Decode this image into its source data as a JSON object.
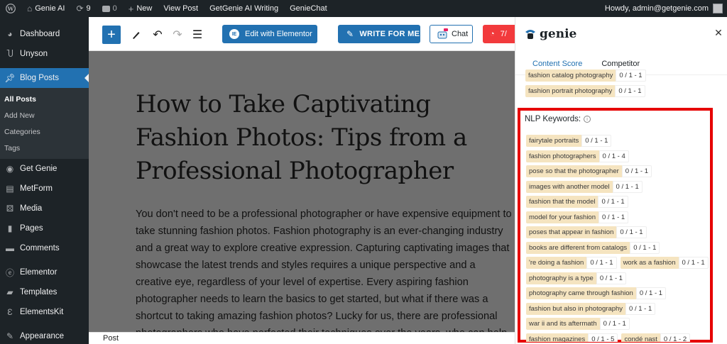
{
  "adminbar": {
    "site_name": "Genie AI",
    "updates_count": "9",
    "comments_count": "0",
    "new_label": "New",
    "view_post": "View Post",
    "getgenie_writing": "GetGenie AI Writing",
    "geniechat": "GenieChat",
    "howdy": "Howdy, admin@getgenie.com"
  },
  "sidebar": {
    "items": [
      {
        "label": "Dashboard",
        "icon": "dashboard-icon"
      },
      {
        "label": "Unyson",
        "icon": "unyson-icon"
      },
      {
        "label": "Blog Posts",
        "icon": "pin-icon",
        "active": true
      },
      {
        "label": "Get Genie",
        "icon": "genie-icon"
      },
      {
        "label": "MetForm",
        "icon": "form-icon"
      },
      {
        "label": "Media",
        "icon": "media-icon"
      },
      {
        "label": "Pages",
        "icon": "pages-icon"
      },
      {
        "label": "Comments",
        "icon": "comment-icon"
      },
      {
        "label": "Elementor",
        "icon": "elementor-icon"
      },
      {
        "label": "Templates",
        "icon": "folder-icon"
      },
      {
        "label": "ElementsKit",
        "icon": "elementskit-icon"
      },
      {
        "label": "Appearance",
        "icon": "brush-icon"
      }
    ],
    "submenu": [
      "All Posts",
      "Add New",
      "Categories",
      "Tags"
    ]
  },
  "toolbar": {
    "edit_elementor": "Edit with Elementor",
    "write_for_me": "WRITE FOR ME",
    "chat": "Chat",
    "red_button": "7/"
  },
  "editor": {
    "title": "How to Take Captivating Fashion Photos: Tips from a Professional Photographer",
    "body": "You don't need to be a professional photographer or have expensive equipment to take stunning fashion photos. Fashion photography is an ever-changing industry and a great way to explore creative expression. Capturing captivating images that showcase the latest trends and styles requires a unique perspective and a creative eye, regardless of your level of expertise. Every aspiring fashion photographer needs to learn the basics to get started, but what if there was a shortcut to taking amazing fashion photos? Lucky for us, there are professional photographers who have perfected their techniques over the years, who can help",
    "status_label": "Post"
  },
  "panel": {
    "logo_text": "genie",
    "tabs": [
      "Content Score",
      "Competitor"
    ],
    "top_keywords": [
      {
        "kw": "fashion catalog photography",
        "ct": "0 / 1 - 1"
      },
      {
        "kw": "fashion portrait photography",
        "ct": "0 / 1 - 1"
      }
    ],
    "nlp_title": "NLP Keywords:",
    "nlp_rows": [
      [
        {
          "kw": "fairytale portraits",
          "ct": "0 / 1 - 1"
        }
      ],
      [
        {
          "kw": "fashion photographers",
          "ct": "0 / 1 - 4"
        }
      ],
      [
        {
          "kw": "pose so that the photographer",
          "ct": "0 / 1 - 1"
        }
      ],
      [
        {
          "kw": "images with another model",
          "ct": "0 / 1 - 1"
        }
      ],
      [
        {
          "kw": "fashion that the model",
          "ct": "0 / 1 - 1"
        }
      ],
      [
        {
          "kw": "model for your fashion",
          "ct": "0 / 1 - 1"
        }
      ],
      [
        {
          "kw": "poses that appear in fashion",
          "ct": "0 / 1 - 1"
        }
      ],
      [
        {
          "kw": "books are different from catalogs",
          "ct": "0 / 1 - 1"
        }
      ],
      [
        {
          "kw": "'re doing a fashion",
          "ct": "0 / 1 - 1"
        },
        {
          "kw": "work as a fashion",
          "ct": "0 / 1 - 1"
        }
      ],
      [
        {
          "kw": "photography is a type",
          "ct": "0 / 1 - 1"
        }
      ],
      [
        {
          "kw": "photography came through fashion",
          "ct": "0 / 1 - 1"
        }
      ],
      [
        {
          "kw": "fashion but also in photography",
          "ct": "0 / 1 - 1"
        }
      ],
      [
        {
          "kw": "war ii and its aftermath",
          "ct": "0 / 1 - 1"
        }
      ],
      [
        {
          "kw": "fashion magazines",
          "ct": "0 / 1 - 5"
        },
        {
          "kw": "condé nast",
          "ct": "0 / 1 - 2"
        }
      ]
    ]
  },
  "colors": {
    "admin_dark": "#1d2327",
    "wp_blue": "#2271b1",
    "highlight_red": "#e60000",
    "chip_bg": "#f5e4c0",
    "red_button": "#f23a3c"
  }
}
